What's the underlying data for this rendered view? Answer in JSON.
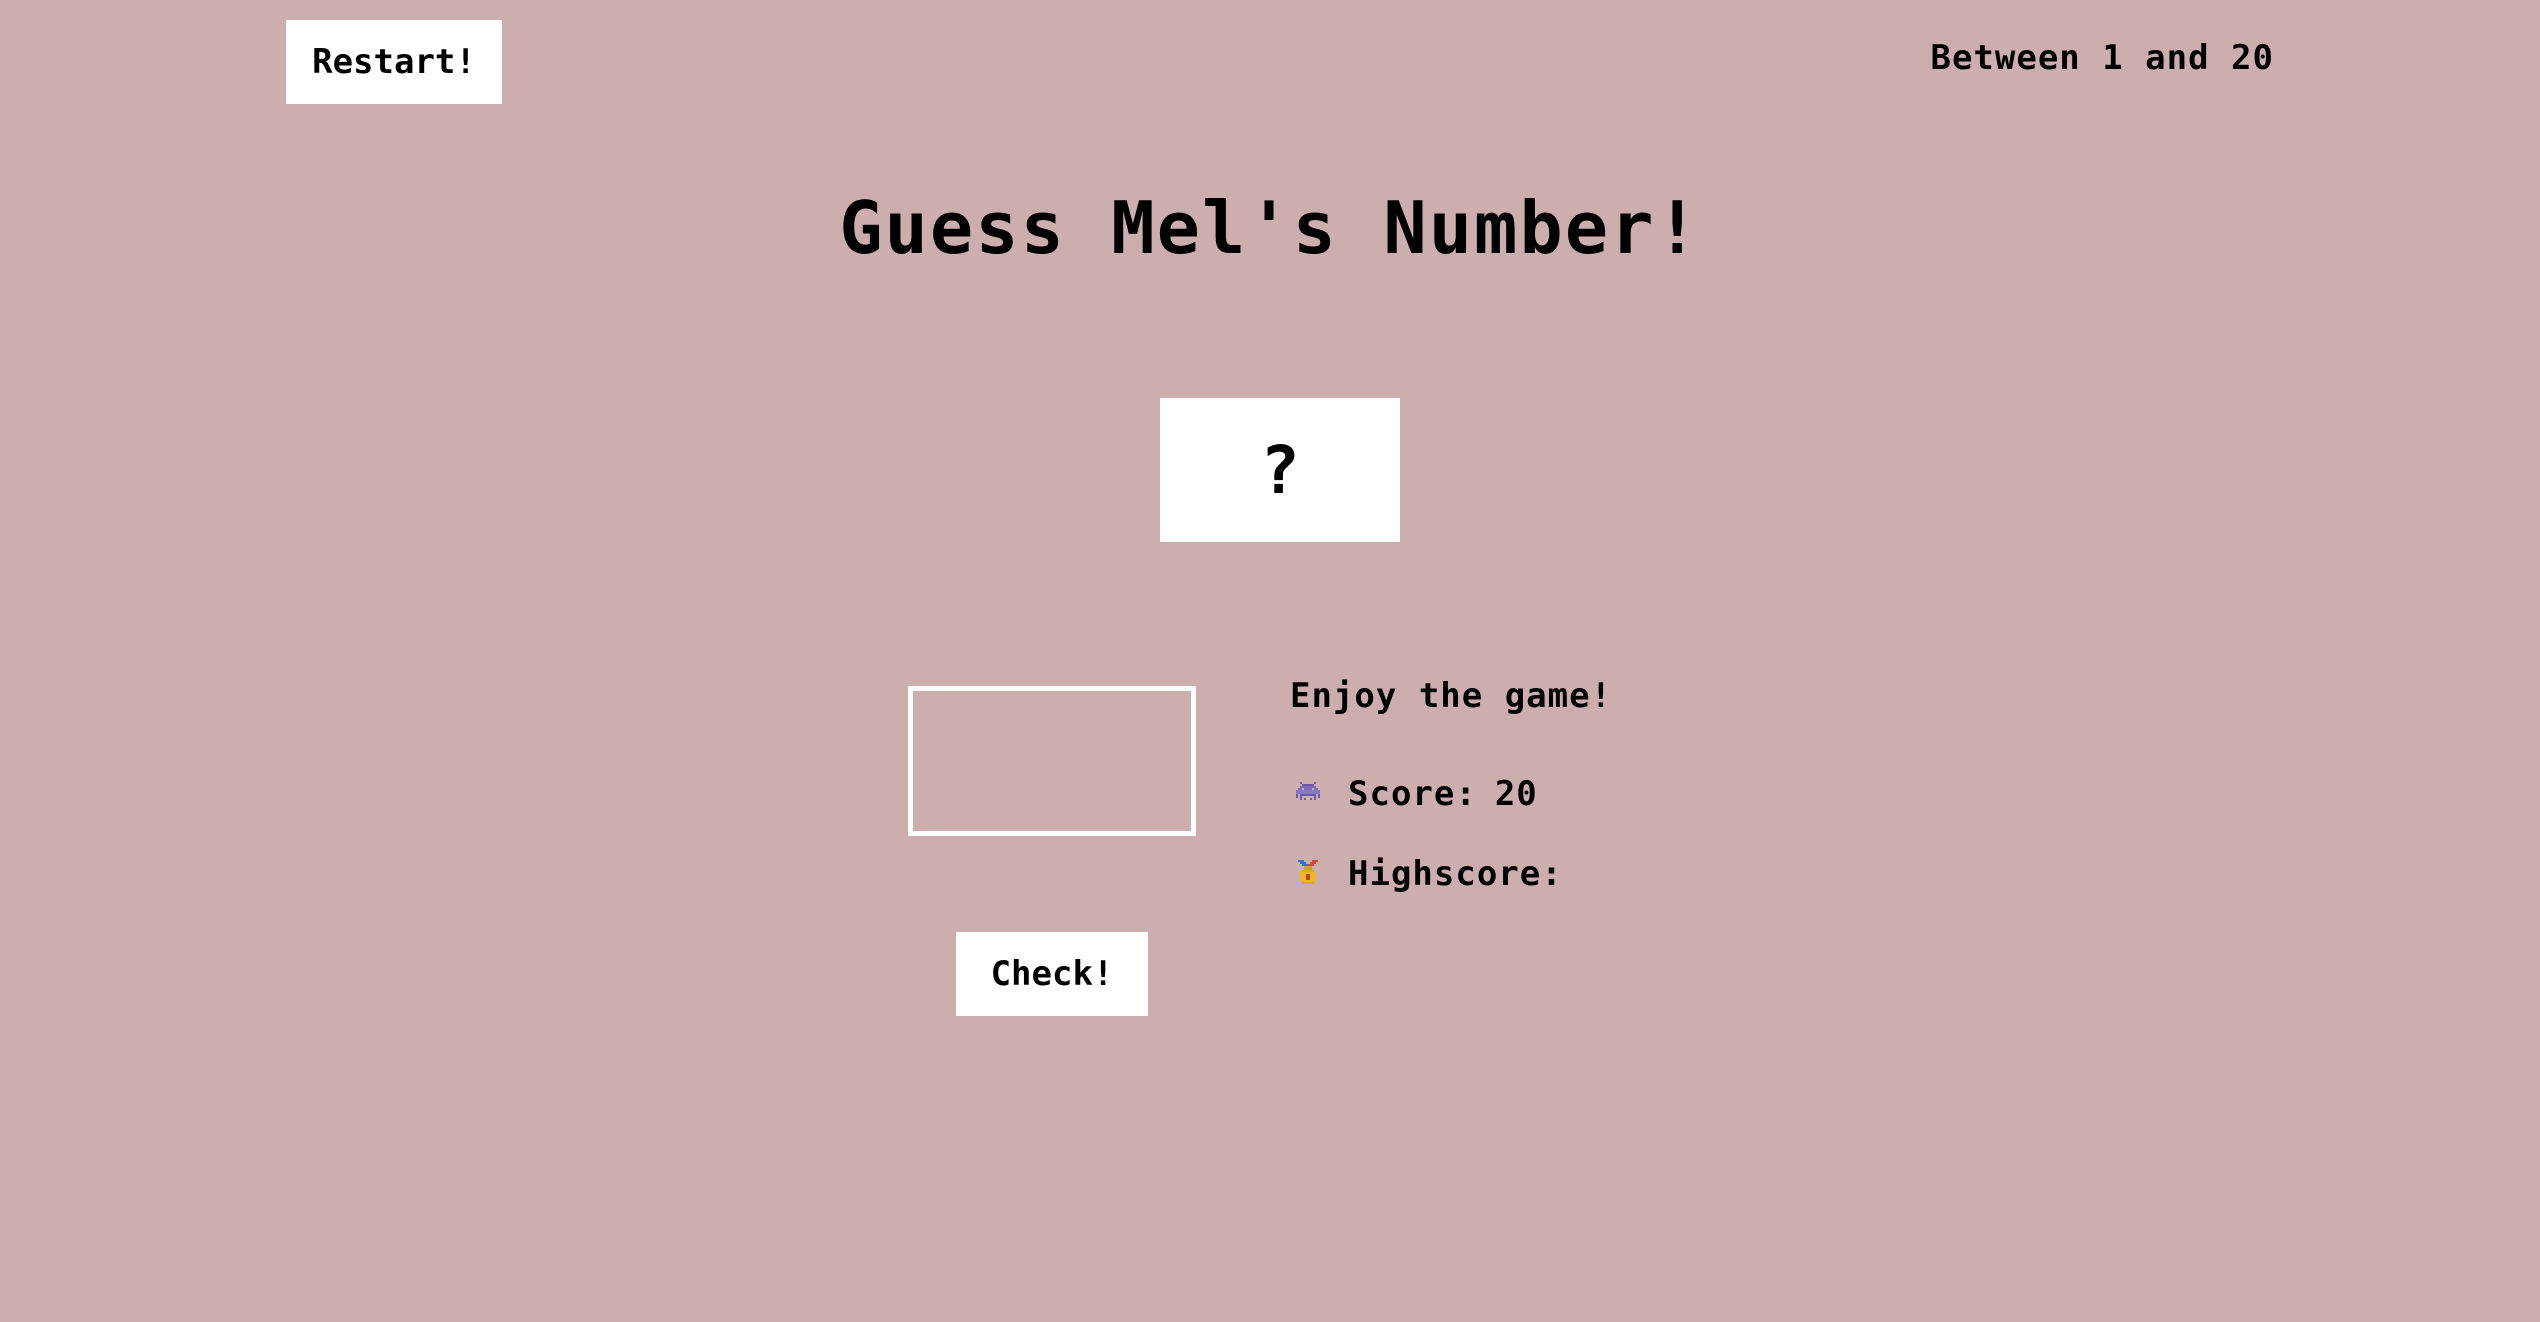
{
  "header": {
    "restart_label": "Restart!",
    "range_text": "Between 1 and 20"
  },
  "title": "Guess Mel's Number!",
  "secret_number": {
    "display": "?"
  },
  "guess_input": {
    "value": "",
    "placeholder": ""
  },
  "check_label": "Check!",
  "status": {
    "message": "Enjoy the game!",
    "score_label": "Score:",
    "score_value": "20",
    "highscore_label": "Highscore:",
    "highscore_value": "",
    "score_icon": "alien-monster-icon",
    "highscore_icon": "medal-icon"
  },
  "colors": {
    "background": "#cdaeaf",
    "panel": "#ffffff",
    "text": "#000000"
  }
}
